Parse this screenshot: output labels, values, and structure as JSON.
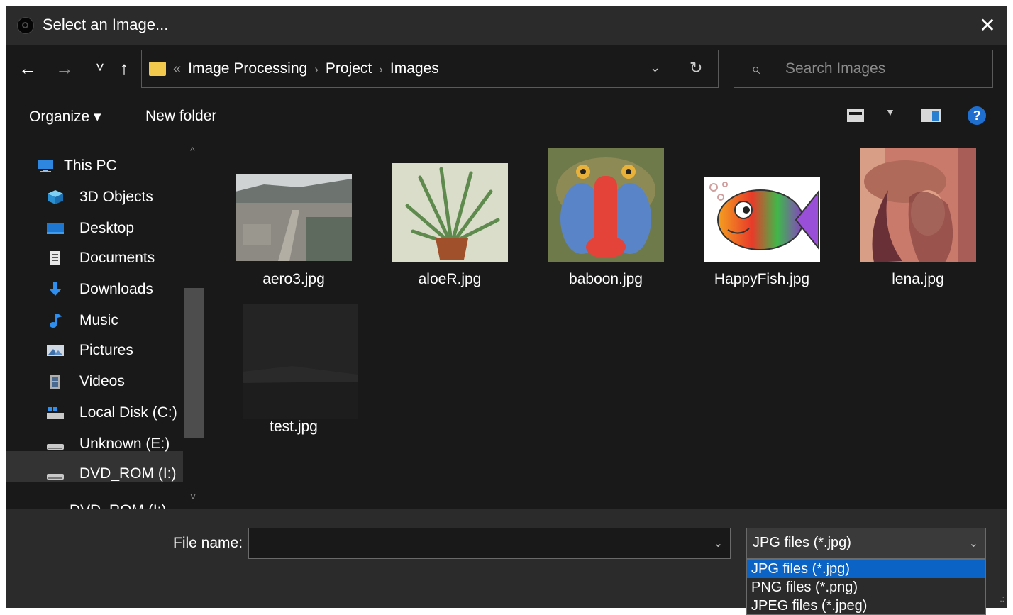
{
  "window": {
    "title": "Select an Image...",
    "close_glyph": "✕"
  },
  "nav": {
    "back_glyph": "←",
    "forward_glyph": "→",
    "recent_glyph": "˅",
    "up_glyph": "↑",
    "breadcrumb_prefix": "«",
    "breadcrumbs": [
      "Image Processing",
      "Project",
      "Images"
    ],
    "breadcrumb_sep": "›",
    "address_dropdown_glyph": "⌄",
    "refresh_glyph": "↻",
    "search_placeholder": "Search Images",
    "search_glyph": "⌕"
  },
  "toolbar": {
    "organize_label": "Organize ▾",
    "new_folder_label": "New folder",
    "view_dropdown_glyph": "▼",
    "help_glyph": "?"
  },
  "sidebar": {
    "items": [
      {
        "label": "This PC",
        "icon": "computer-icon",
        "color": "#2e86de"
      },
      {
        "label": "3D Objects",
        "icon": "cube-icon",
        "color": "#3aa6e0"
      },
      {
        "label": "Desktop",
        "icon": "desktop-icon",
        "color": "#1e78d2"
      },
      {
        "label": "Documents",
        "icon": "document-icon",
        "color": "#dcdcdc"
      },
      {
        "label": "Downloads",
        "icon": "download-arrow-icon",
        "color": "#2f8ff0"
      },
      {
        "label": "Music",
        "icon": "music-note-icon",
        "color": "#2f8ff0"
      },
      {
        "label": "Pictures",
        "icon": "pictures-icon",
        "color": "#cfd8e3"
      },
      {
        "label": "Videos",
        "icon": "film-icon",
        "color": "#b0b0b0"
      },
      {
        "label": "Local Disk (C:)",
        "icon": "disk-icon",
        "color": "#c9c9c9"
      },
      {
        "label": "Unknown (E:)",
        "icon": "drive-icon",
        "color": "#c9c9c9"
      },
      {
        "label": "DVD_ROM (I:)",
        "icon": "dvd-drive-icon",
        "color": "#c9c9c9",
        "selected": true
      },
      {
        "label": "DVD_ROM (I:)",
        "icon": "dvd-drive-icon",
        "color": "#c9c9c9"
      }
    ],
    "scroll_up_glyph": "^",
    "scroll_down_glyph": "˅"
  },
  "files": [
    {
      "name": "aero3.jpg",
      "icon": "aerial-photo-thumbnail"
    },
    {
      "name": "aloeR.jpg",
      "icon": "aloe-plant-thumbnail"
    },
    {
      "name": "baboon.jpg",
      "icon": "baboon-thumbnail"
    },
    {
      "name": "HappyFish.jpg",
      "icon": "fish-cartoon-thumbnail"
    },
    {
      "name": "lena.jpg",
      "icon": "portrait-thumbnail"
    },
    {
      "name": "test.jpg",
      "icon": "dark-photo-thumbnail"
    }
  ],
  "footer": {
    "file_name_label": "File name:",
    "file_name_value": "",
    "dropdown_glyph": "⌄",
    "file_type_selected": "JPG files (*.jpg)",
    "file_type_options": [
      "JPG files (*.jpg)",
      "PNG files (*.png)",
      "JPEG files (*.jpeg)"
    ],
    "resize_grip_glyph": ".:"
  }
}
